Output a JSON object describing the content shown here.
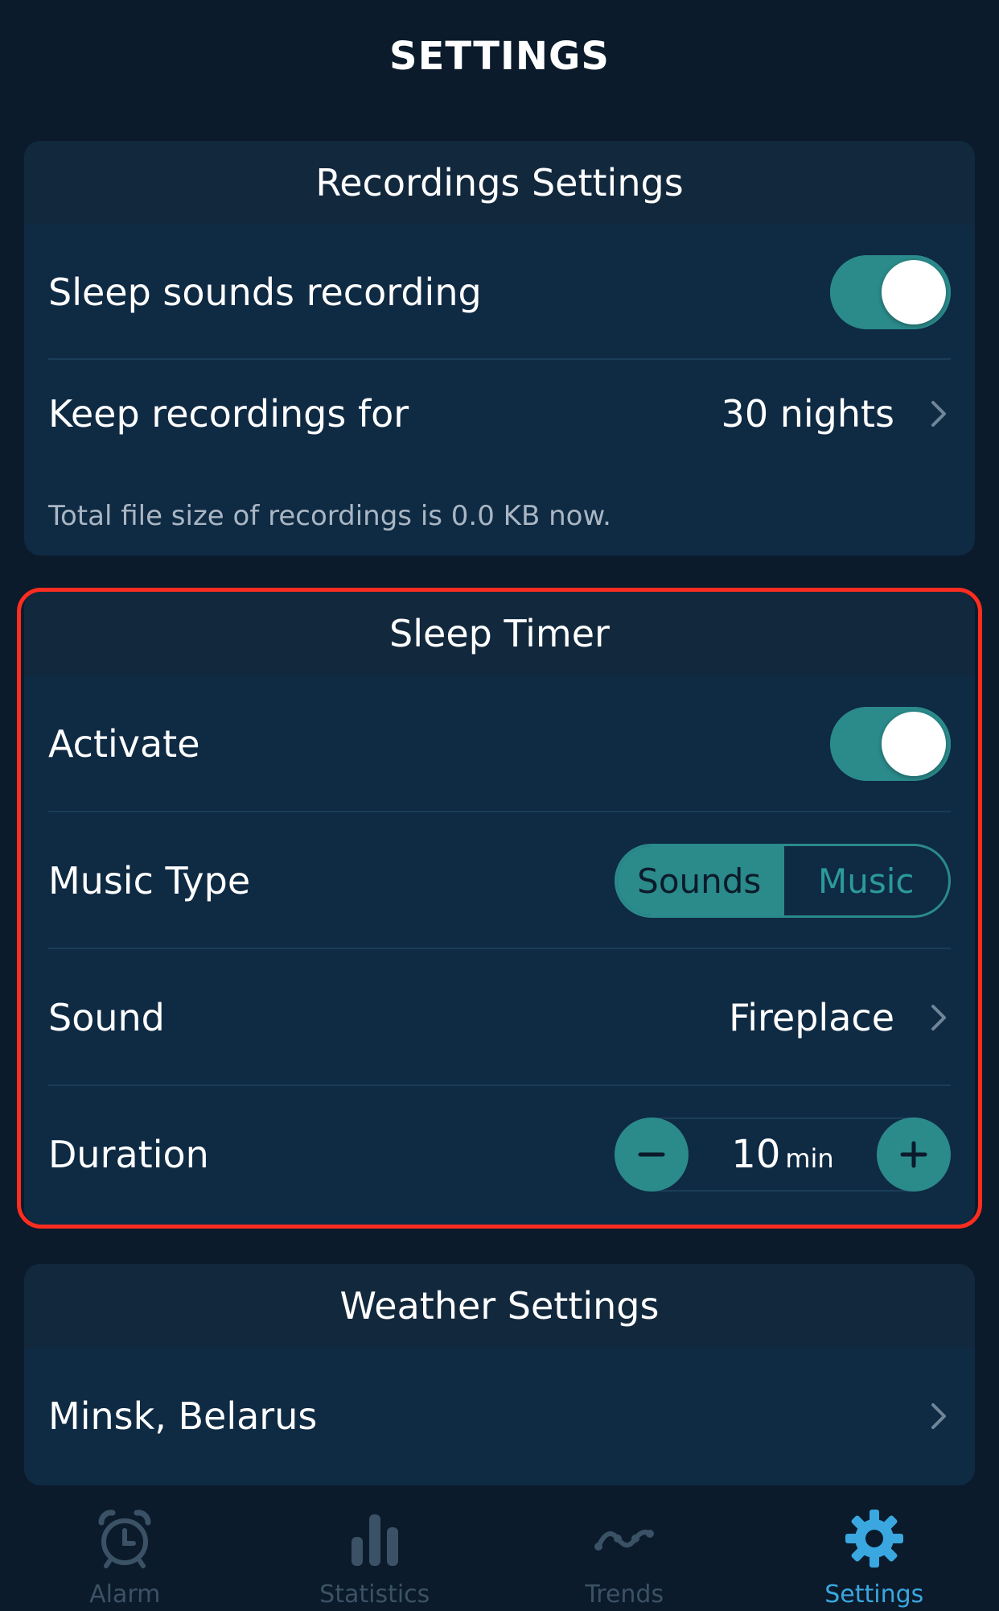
{
  "page": {
    "title": "SETTINGS"
  },
  "colors": {
    "background": "#0b1b2b",
    "card": "#0f2a43",
    "accent_teal": "#2b8a8a",
    "highlight_red": "#ff2d20",
    "active_tab": "#3aa7e0",
    "inactive_tab": "#3b5266"
  },
  "recordings": {
    "header": "Recordings Settings",
    "sleep_sounds_label": "Sleep sounds recording",
    "sleep_sounds_on": true,
    "keep_label": "Keep recordings for",
    "keep_value": "30 nights",
    "note": "Total file size of recordings is 0.0 KB now."
  },
  "sleep_timer": {
    "header": "Sleep Timer",
    "activate_label": "Activate",
    "activate_on": true,
    "music_type_label": "Music Type",
    "music_type_options": [
      "Sounds",
      "Music"
    ],
    "music_type_selected": "Sounds",
    "sound_label": "Sound",
    "sound_value": "Fireplace",
    "duration_label": "Duration",
    "duration_value": "10",
    "duration_unit": "min"
  },
  "weather": {
    "header": "Weather Settings",
    "location": "Minsk, Belarus"
  },
  "tabs": [
    {
      "label": "Alarm",
      "icon": "alarm-clock-icon",
      "active": false
    },
    {
      "label": "Statistics",
      "icon": "bar-chart-icon",
      "active": false
    },
    {
      "label": "Trends",
      "icon": "trend-line-icon",
      "active": false
    },
    {
      "label": "Settings",
      "icon": "gear-icon",
      "active": true
    }
  ]
}
